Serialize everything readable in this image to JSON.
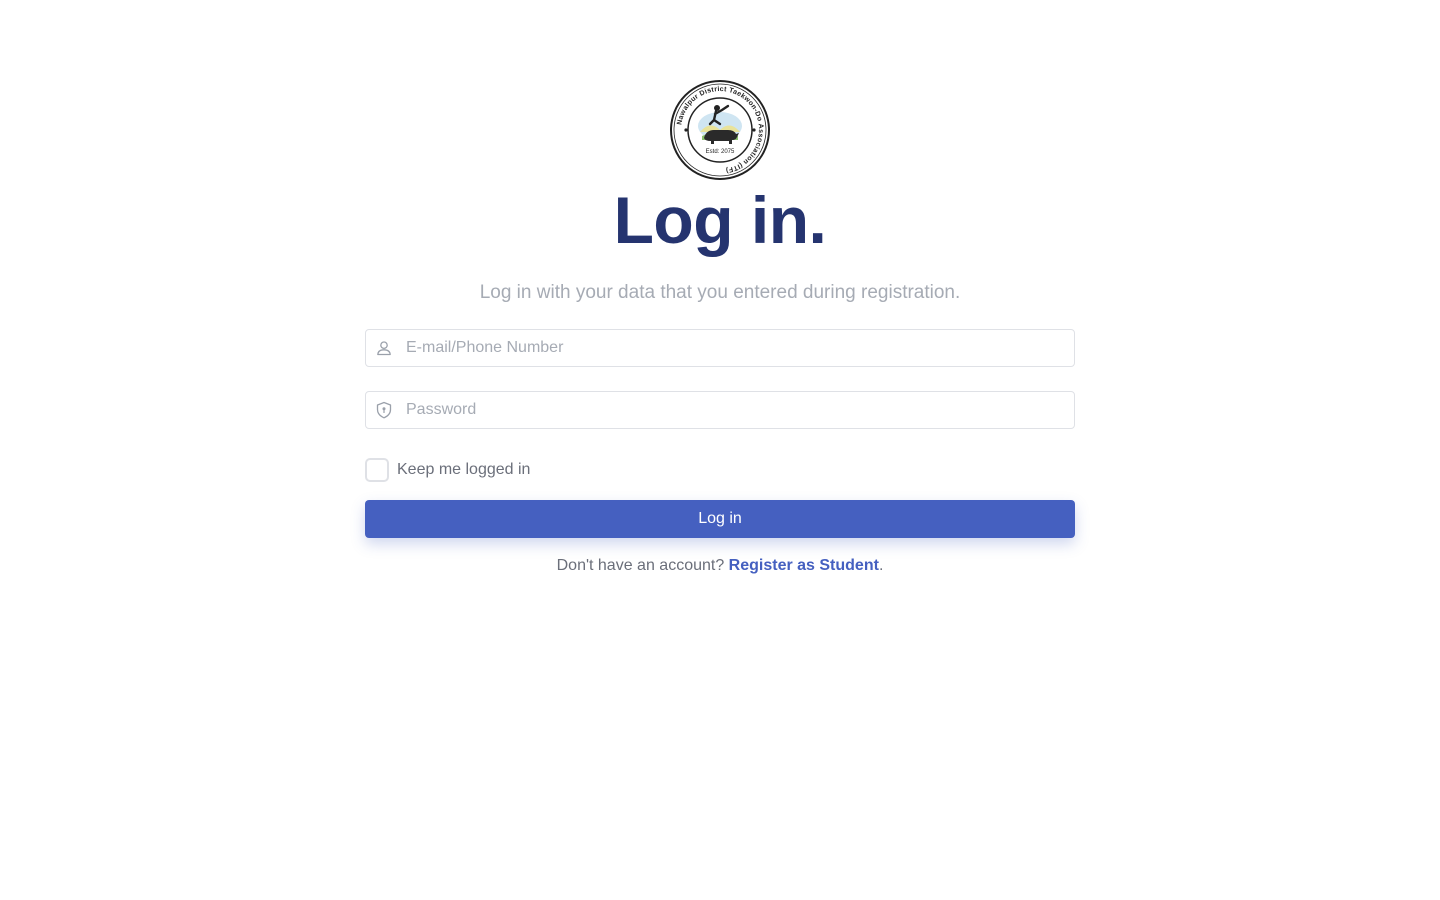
{
  "brand": {
    "logo_ring_text_top": "Nawalpur District Taekwon-Do Association (ITF)",
    "logo_center_text": "Estd: 2075"
  },
  "header": {
    "title": "Log in.",
    "subtitle": "Log in with your data that you entered during registration."
  },
  "form": {
    "email": {
      "value": "",
      "placeholder": "E-mail/Phone Number",
      "icon": "user-icon"
    },
    "password": {
      "value": "",
      "placeholder": "Password",
      "icon": "shield-lock-icon"
    },
    "remember": {
      "label": "Keep me logged in",
      "checked": false
    },
    "submit_label": "Log in"
  },
  "footer": {
    "prompt": "Don't have an account?",
    "register_link": "Register as Student",
    "suffix": "."
  },
  "colors": {
    "primary": "#4560c0",
    "title": "#25346f",
    "muted": "#a6abb4",
    "border": "#dfe1e6"
  }
}
